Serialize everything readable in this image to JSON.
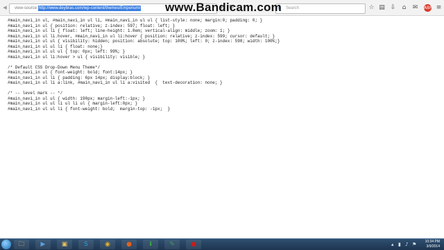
{
  "browser": {
    "url_prefix": "view-source:",
    "url": "http://www.deybras.com/wp-content/themes/Emporium/",
    "search_placeholder": "Search",
    "search_engine_icon": "g"
  },
  "watermark": "www.Bandicam.com",
  "source_lines": [
    "#main_navi_in ul, #main_navi_in ul li, #main_navi_in ul ul { list-style: none; margin:0; padding: 0; }",
    "#main_navi_in ul { position: relative; z-index: 597; float: left; }",
    "#main_navi_in ul li { float: left; line-height: 1.8em; vertical-align: middle; zoom: 1; }",
    "#main_navi_in ul li.hover, #main_navi_in ul li:hover { position: relative; z-index: 599; cursor: default; }",
    "#main_navi_in ul ul { visibility: hidden; position: absolute; top: 100%; left: 0; z-index: 598; width: 100%;}",
    "#main_navi_in ul ul li { float: none;}",
    "#main_navi_in ul ul ul { top: 0px; left: 99%; }",
    "#main_navi_in ul li:hover > ul { visibility: visible; }",
    "",
    "/* Default CSS Drop-Down Menu Theme*/",
    "#main_navi_in ul { font-weight: bold; font:14px; }",
    "#main_navi_in ul li { padding: 6px 14px; display:block; }",
    "#main_navi_in ul li a:link, #main_navi_in ul li a:visited  {  text-decoration: none; }",
    "",
    "/* -- level mark -- */",
    "#main_navi_in ul ul { width: 190px; margin-left:-1px; }",
    "#main_navi_in ul ul li ul li ul { margin-left:0px; }",
    "#main_navi_in ul ul li { font-weight: bold;  margin-top: -1px;  }"
  ],
  "taskbar": {
    "time": "10:34 PM",
    "date": "3/9/2014",
    "apps": [
      "windows-explorer-icon",
      "media-player-icon",
      "folder-icon",
      "skype-icon",
      "chrome-icon",
      "firefox-icon",
      "download-icon",
      "paint-icon",
      "bandicam-icon"
    ]
  }
}
